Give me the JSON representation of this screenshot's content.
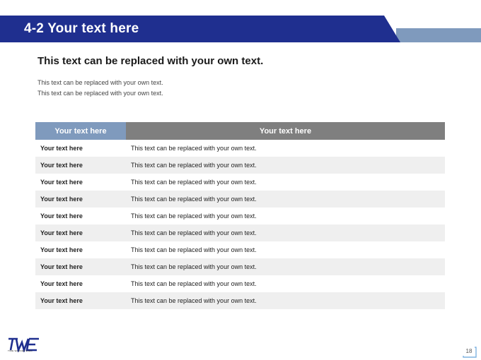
{
  "header": {
    "title": "4-2 Your text here",
    "colors": {
      "primary": "#1f2f8f",
      "accent": "#7f9abd"
    }
  },
  "intro": {
    "subtitle": "This text can be replaced with your own text.",
    "lines": [
      "This text can be replaced with your own text.",
      "This text can be replaced with your own text."
    ]
  },
  "table": {
    "headers": [
      "Your text here",
      "Your text here"
    ],
    "rows": [
      [
        "Your text here",
        "This text can be replaced with your own text."
      ],
      [
        "Your text here",
        "This text can be replaced with your own text."
      ],
      [
        "Your text here",
        "This text can be replaced with your own text."
      ],
      [
        "Your text here",
        "This text can be replaced with your own text."
      ],
      [
        "Your text here",
        "This text can be replaced with your own text."
      ],
      [
        "Your text here",
        "This text can be replaced with your own text."
      ],
      [
        "Your text here",
        "This text can be replaced with your own text."
      ],
      [
        "Your text here",
        "This text can be replaced with your own text."
      ],
      [
        "Your text here",
        "This text can be replaced with your own text."
      ],
      [
        "Your text here",
        "This text can be replaced with your own text."
      ]
    ]
  },
  "footer": {
    "logo_text": "TWE",
    "logo_subtext": "TIME WARNER EXEC",
    "page_number": "18"
  }
}
